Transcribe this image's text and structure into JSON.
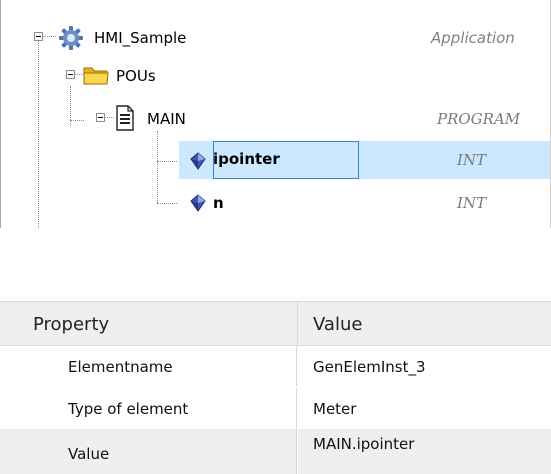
{
  "tree": {
    "nodes": [
      {
        "label": "HMI_Sample",
        "type": "Application",
        "icon": "gear-icon"
      },
      {
        "label": "POUs",
        "type": "",
        "icon": "folder-icon"
      },
      {
        "label": "MAIN",
        "type": "PROGRAM",
        "icon": "document-icon"
      },
      {
        "label": "ipointer",
        "type": "INT",
        "icon": "variable-icon",
        "selected": true,
        "editing": true
      },
      {
        "label": "n",
        "type": "INT",
        "icon": "variable-icon"
      }
    ]
  },
  "properties": {
    "header": {
      "property": "Property",
      "value": "Value"
    },
    "rows": [
      {
        "name": "Elementname",
        "value": "GenElemInst_3"
      },
      {
        "name": "Type of element",
        "value": "Meter"
      },
      {
        "name": "Value",
        "value": "MAIN.ipointer"
      }
    ]
  },
  "colors": {
    "selection": "#cce8ff",
    "edit_border": "#3a7fdc",
    "header_bg": "#efefef"
  }
}
